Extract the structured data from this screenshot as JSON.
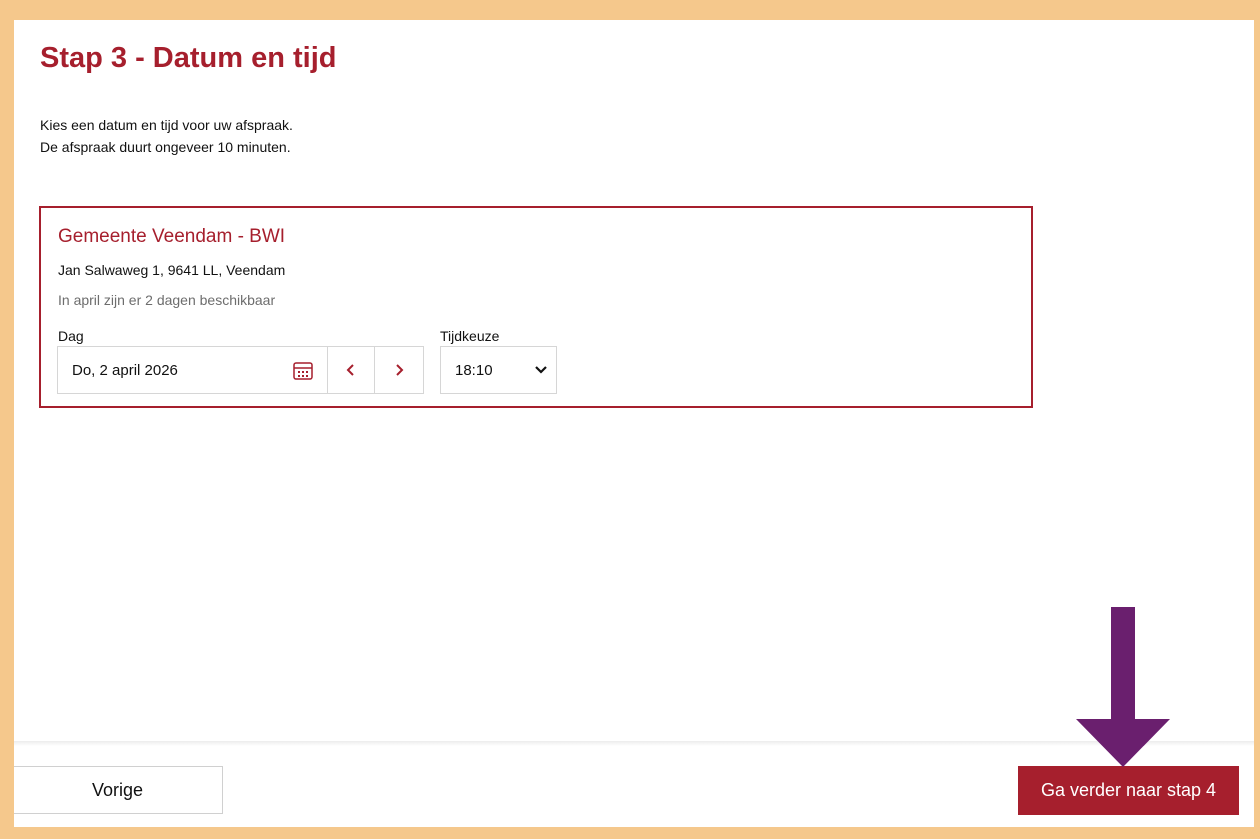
{
  "step": {
    "title": "Stap 3 - Datum en tijd",
    "intro_line1": "Kies een datum en tijd voor uw afspraak.",
    "intro_line2": "De afspraak duurt ongeveer 10 minuten."
  },
  "location": {
    "name": "Gemeente Veendam - BWI",
    "address": "Jan Salwaweg 1, 9641 LL, Veendam",
    "availability": "In april zijn er 2 dagen beschikbaar"
  },
  "date_field": {
    "label": "Dag",
    "value": "Do, 2 april 2026",
    "calendar_icon": "calendar-icon",
    "prev_icon": "chevron-left-icon",
    "next_icon": "chevron-right-icon"
  },
  "time_field": {
    "label": "Tijdkeuze",
    "value": "18:10"
  },
  "footer": {
    "prev_label": "Vorige",
    "next_label": "Ga verder naar stap 4"
  },
  "annotation": {
    "arrow_icon": "arrow-down-icon",
    "arrow_color": "#6a1f6e"
  },
  "colors": {
    "accent": "#a61f2d",
    "frame": "#f5c88c"
  }
}
